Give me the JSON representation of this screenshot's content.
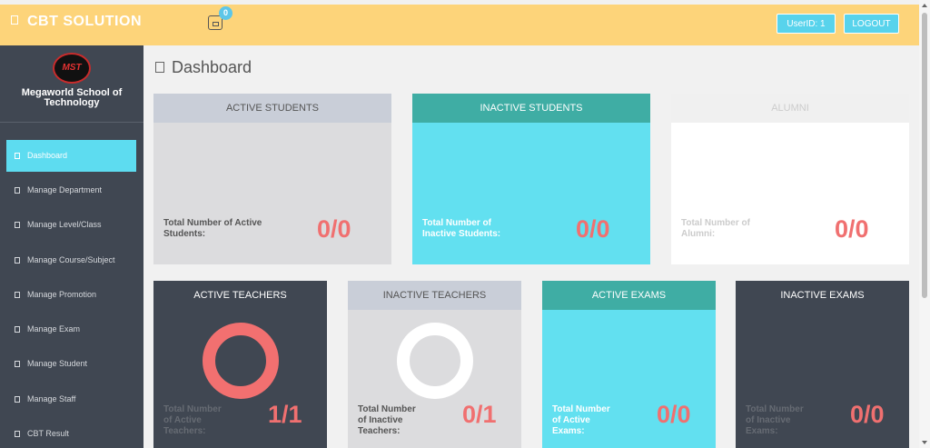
{
  "header": {
    "brand": "CBT SOLUTION",
    "notification_count": "0",
    "user_id_label": "UserID: 1",
    "logout_label": "LOGOUT"
  },
  "sidebar": {
    "logo_text": "MST",
    "school_line1": "Megaworld School of",
    "school_line2": "Technology",
    "items": [
      {
        "label": "Dashboard",
        "active": true
      },
      {
        "label": "Manage Department"
      },
      {
        "label": "Manage Level/Class"
      },
      {
        "label": "Manage Course/Subject"
      },
      {
        "label": "Manage Promotion"
      },
      {
        "label": "Manage Exam"
      },
      {
        "label": "Manage Student"
      },
      {
        "label": "Manage Staff"
      },
      {
        "label": "CBT Result"
      }
    ]
  },
  "main": {
    "title": "Dashboard",
    "cards": {
      "active_students": {
        "title": "ACTIVE STUDENTS",
        "label_1": "Total Number of Active",
        "label_2": "Students:",
        "value": "0/0"
      },
      "inactive_students": {
        "title": "INACTIVE STUDENTS",
        "label_1": "Total Number of",
        "label_2": "Inactive Students:",
        "value": "0/0"
      },
      "alumni": {
        "title": "ALUMNI",
        "label_1": "Total Number of",
        "label_2": "Alumni:",
        "value": "0/0"
      },
      "active_teachers": {
        "title": "ACTIVE TEACHERS",
        "label_1": "Total Number",
        "label_2": "of Active",
        "label_3": "Teachers:",
        "value": "1/1",
        "fill": 1.0
      },
      "inactive_teachers": {
        "title": "INACTIVE TEACHERS",
        "label_1": "Total Number",
        "label_2": "of Inactive",
        "label_3": "Teachers:",
        "value": "0/1",
        "fill": 0.0
      },
      "active_exams": {
        "title": "ACTIVE EXAMS",
        "label_1": "Total Number",
        "label_2": "of Active",
        "label_3": "Exams:",
        "value": "0/0"
      },
      "inactive_exams": {
        "title": "INACTIVE EXAMS",
        "label_1": "Total Number",
        "label_2": "of Inactive",
        "label_3": "Exams:",
        "value": "0/0"
      }
    }
  },
  "colors": {
    "topbar": "#fdd47a",
    "sidebar": "#404752",
    "accent_cyan": "#62e0f0",
    "teal": "#3fada4",
    "value_red": "#f07070"
  }
}
